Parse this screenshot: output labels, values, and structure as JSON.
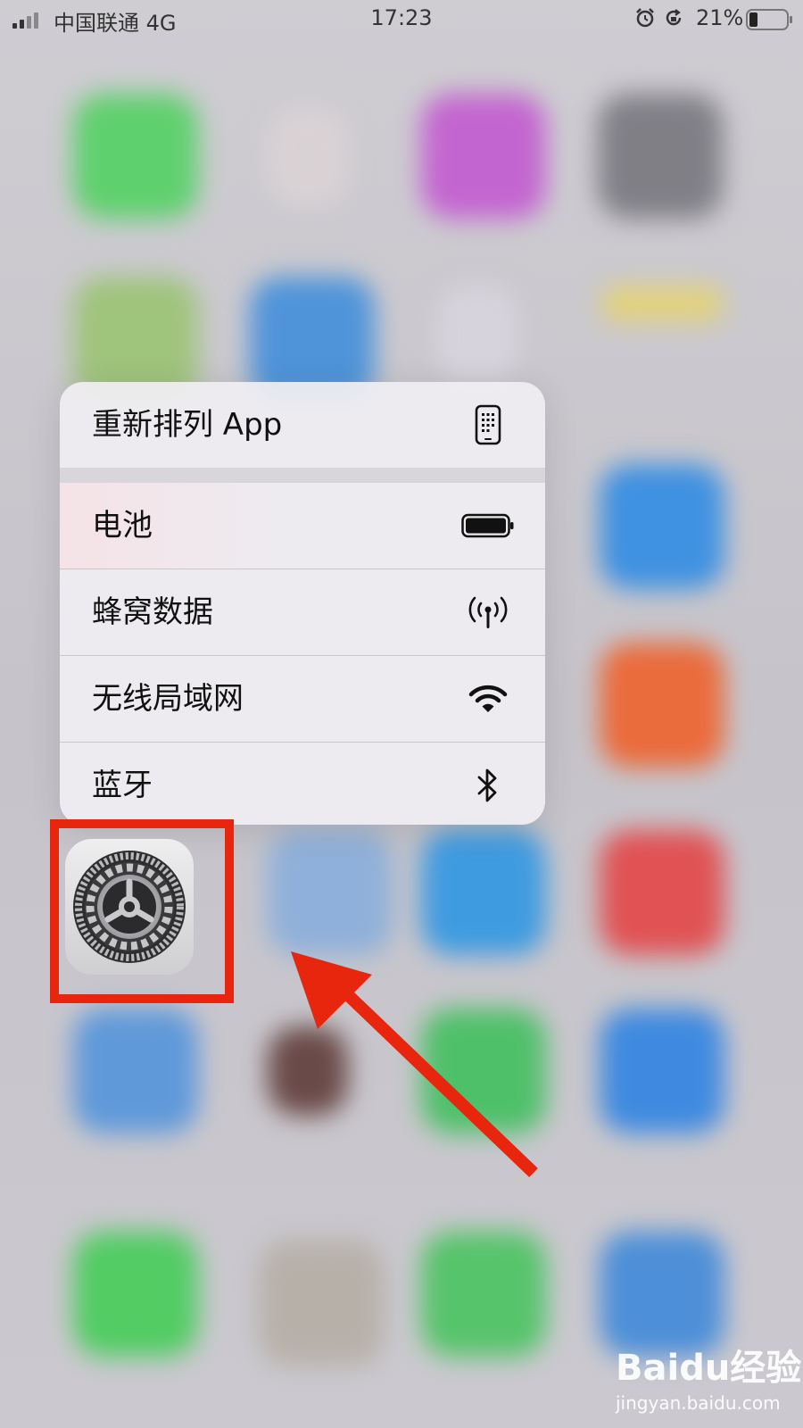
{
  "status_bar": {
    "carrier": "中国联通 4G",
    "time": "17:23",
    "battery_percent": "21%",
    "icons": [
      "signal-icon",
      "alarm-icon",
      "rotation-lock-icon",
      "battery-icon"
    ]
  },
  "context_menu": {
    "items": [
      {
        "label": "重新排列 App",
        "icon": "phone-grid-icon"
      },
      {
        "label": "电池",
        "icon": "battery-icon"
      },
      {
        "label": "蜂窝数据",
        "icon": "cellular-antenna-icon"
      },
      {
        "label": "无线局域网",
        "icon": "wifi-icon"
      },
      {
        "label": "蓝牙",
        "icon": "bluetooth-icon"
      }
    ]
  },
  "focused_app": {
    "icon": "settings-gear-icon"
  },
  "annotation": {
    "highlight_color": "#e8260e"
  },
  "watermark": {
    "logo": "Baidu经验",
    "url": "jingyan.baidu.com"
  }
}
